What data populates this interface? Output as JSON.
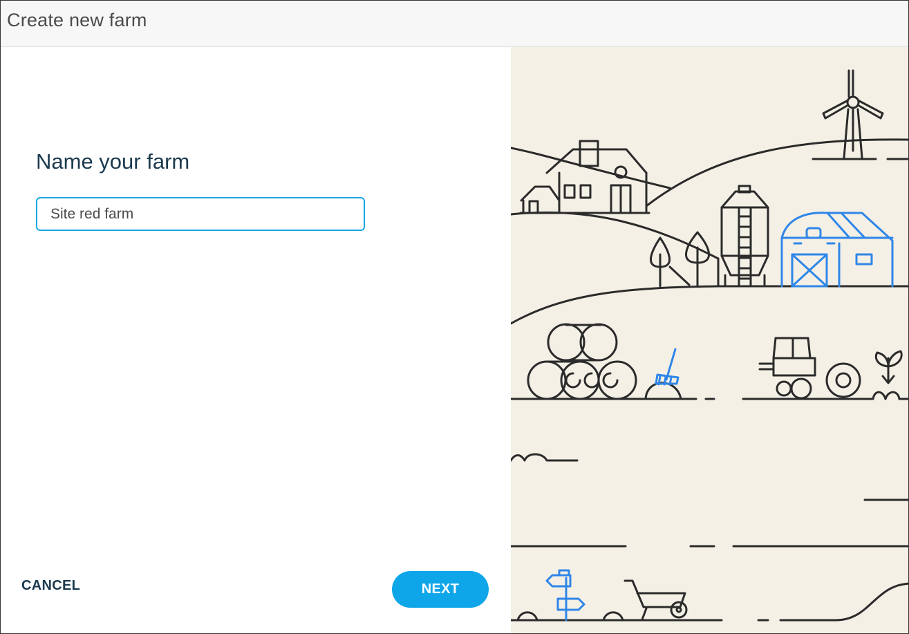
{
  "window": {
    "title": "Create new farm"
  },
  "form": {
    "heading": "Name your farm",
    "farm_name_value": "Site red farm"
  },
  "actions": {
    "cancel_label": "CANCEL",
    "next_label": "NEXT"
  },
  "colors": {
    "accent": "#0ea5e9",
    "heading": "#1b3a4e",
    "illustration_bg": "#f4f0e6",
    "line_art": "#2b2b2b",
    "line_art_accent": "#2f86e8"
  }
}
